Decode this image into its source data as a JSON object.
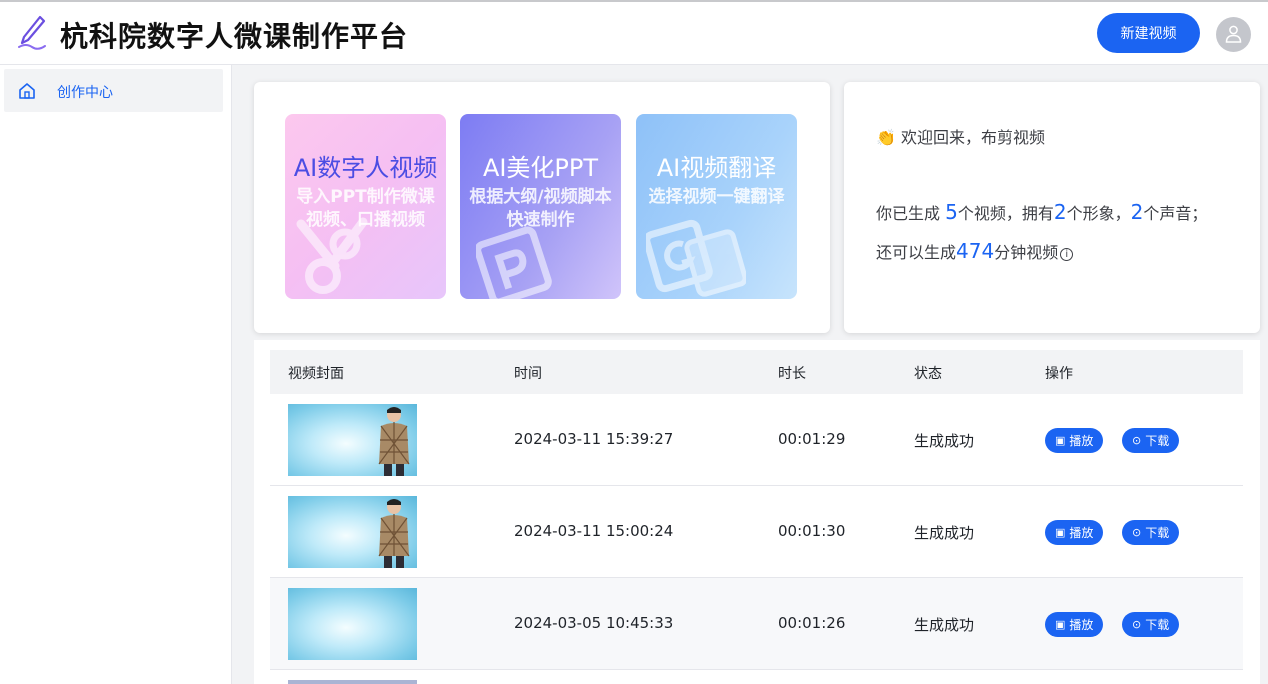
{
  "header": {
    "app_title": "杭科院数字人微课制作平台",
    "new_video_label": "新建视频",
    "brand_color": "#1b64f2"
  },
  "sidebar": {
    "items": [
      {
        "label": "创作中心",
        "icon": "home-icon",
        "active": true
      }
    ]
  },
  "features": [
    {
      "title": "AI数字人视频",
      "desc": "导入PPT制作微课视频、口播视频",
      "icon": "scissors-icon"
    },
    {
      "title": "AI美化PPT",
      "desc": "根据大纲/视频脚本快速制作",
      "icon": "ppt-icon"
    },
    {
      "title": "AI视频翻译",
      "desc": "选择视频一键翻译",
      "icon": "translate-icon"
    }
  ],
  "welcome": {
    "greeting": "👏 欢迎回来，布剪视频",
    "stats_prefix": "你已生成 ",
    "videos_count": "5",
    "videos_unit": "个视频，拥有",
    "avatars_count": "2",
    "avatars_unit": "个形象，",
    "voices_count": "2",
    "voices_unit": "个声音；",
    "remaining_prefix": "还可以生成",
    "remaining_minutes": "474",
    "remaining_unit": "分钟视频",
    "info_icon": "ⓘ"
  },
  "table": {
    "columns": [
      "视频封面",
      "时间",
      "时长",
      "状态",
      "操作"
    ],
    "rows": [
      {
        "time": "2024-03-11 15:39:27",
        "duration": "00:01:29",
        "status": "生成成功",
        "has_person": true
      },
      {
        "time": "2024-03-11 15:00:24",
        "duration": "00:01:30",
        "status": "生成成功",
        "has_person": true
      },
      {
        "time": "2024-03-05 10:45:33",
        "duration": "00:01:26",
        "status": "生成成功",
        "has_person": false
      }
    ],
    "play_label": "播放",
    "download_label": "下载"
  }
}
